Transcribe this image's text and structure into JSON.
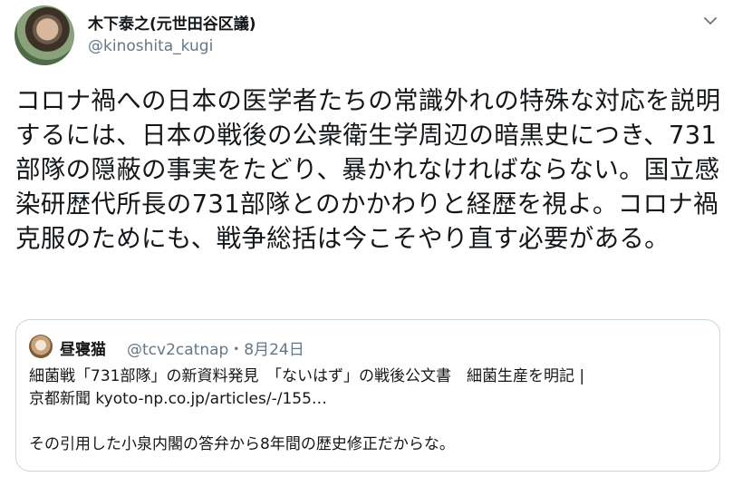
{
  "author": {
    "display_name": "木下泰之(元世田谷区議)",
    "handle": "@kinoshita_kugi",
    "avatar": "author-avatar"
  },
  "menu_icon": "chevron-down-icon",
  "tweet": {
    "text": "コロナ禍への日本の医学者たちの常識外れの特殊な対応を説明するには、日本の戦後の公衆衛生学周辺の暗黒史につき、731部隊の隠蔽の事実をたどり、暴かれなければならない。国立感染研歴代所長の731部隊とのかかわりと経歴を視よ。コロナ禍克服のためにも、戦争総括は今こそやり直す必要がある。"
  },
  "quoted_tweet": {
    "display_name": "昼寝猫",
    "handle_date": "@tcv2catnap・8月24日",
    "line1": "細菌戦「731部隊」の新資料発見　「ないはず」の戦後公文書　細菌生産を明記 |",
    "line2": "京都新聞 kyoto-np.co.jp/articles/-/155…",
    "line3": "その引用した小泉内閣の答弁から8年間の歴史修正だからな。"
  },
  "colors": {
    "text": "#14171a",
    "secondary": "#657786",
    "border": "#ccd6dd"
  }
}
